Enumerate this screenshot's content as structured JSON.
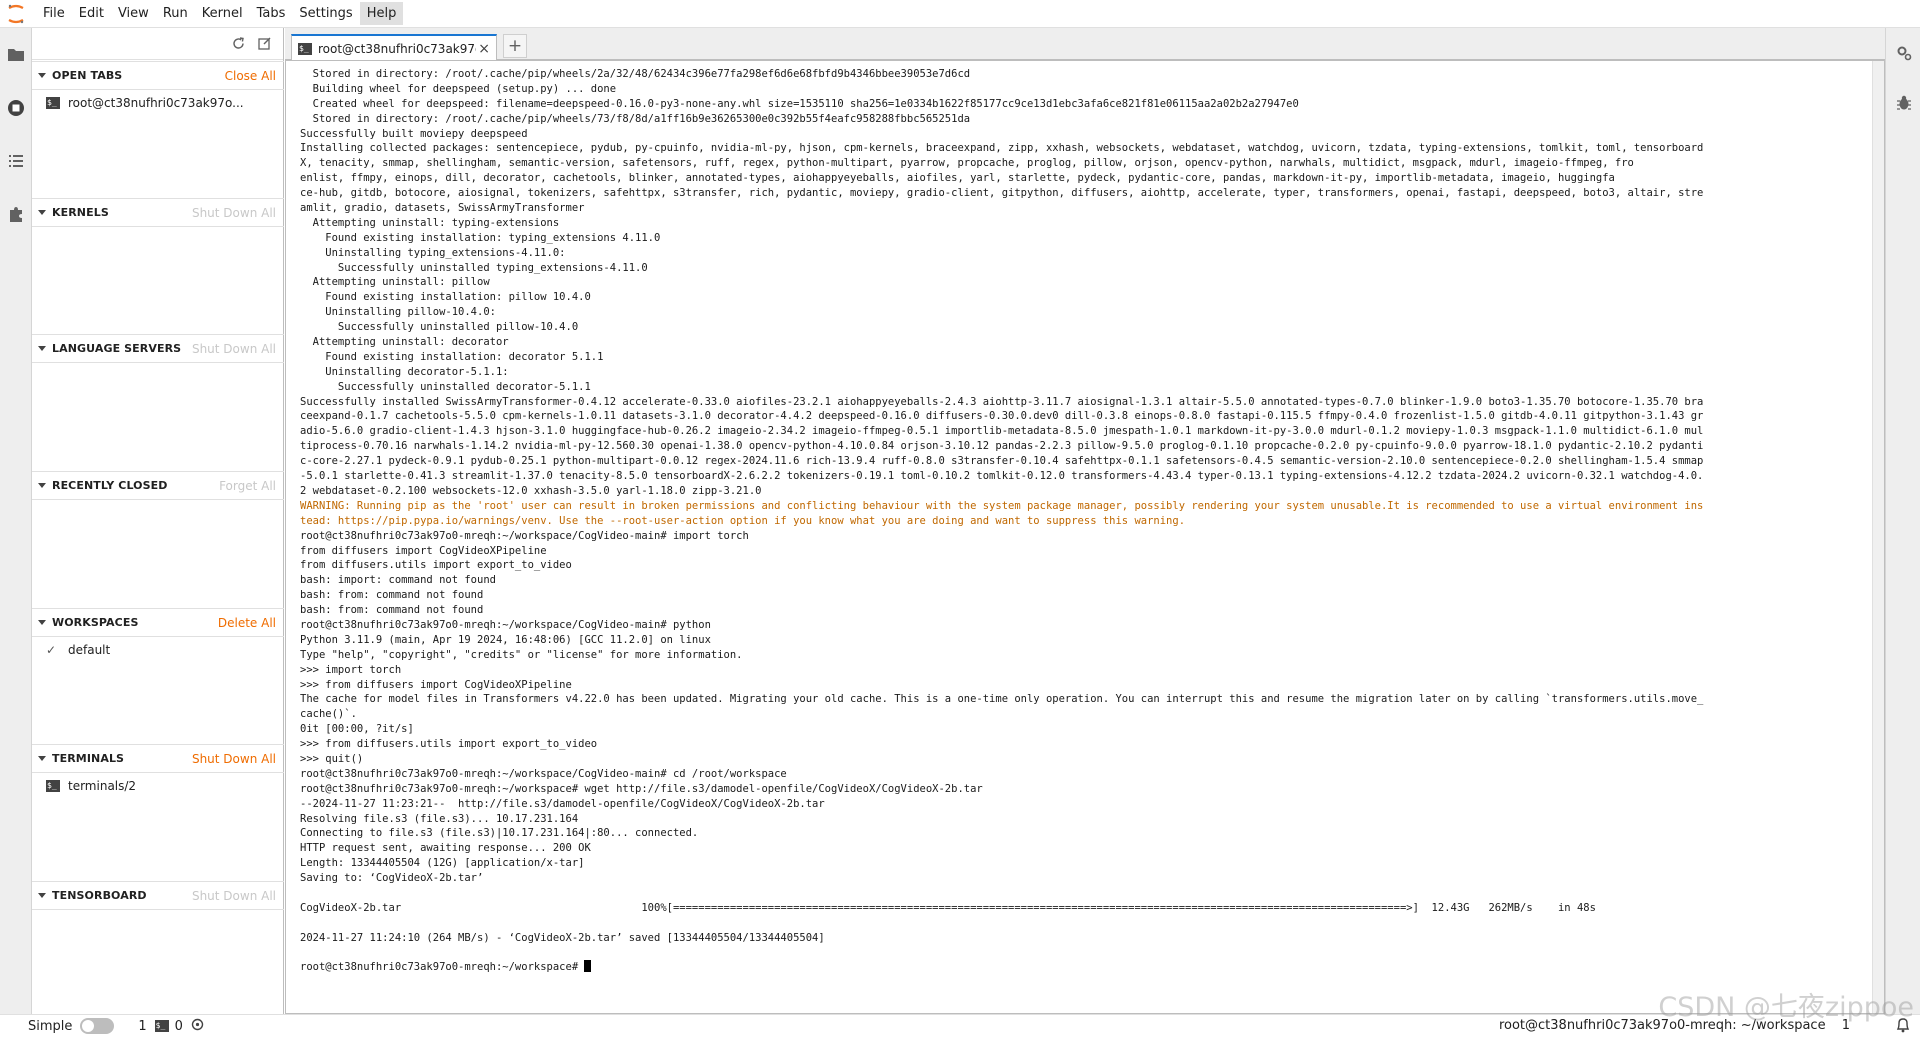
{
  "menubar": {
    "items": [
      "File",
      "Edit",
      "View",
      "Run",
      "Kernel",
      "Tabs",
      "Settings",
      "Help"
    ]
  },
  "sidebar": {
    "open_tabs": {
      "title": "OPEN TABS",
      "action": "Close All",
      "items": [
        "root@ct38nufhri0c73ak97o..."
      ]
    },
    "kernels": {
      "title": "KERNELS",
      "action": "Shut Down All"
    },
    "language_servers": {
      "title": "LANGUAGE SERVERS",
      "action": "Shut Down All"
    },
    "recently_closed": {
      "title": "RECENTLY CLOSED",
      "action": "Forget All"
    },
    "workspaces": {
      "title": "WORKSPACES",
      "action": "Delete All",
      "items": [
        "default"
      ]
    },
    "terminals": {
      "title": "TERMINALS",
      "action": "Shut Down All",
      "items": [
        "terminals/2"
      ]
    },
    "tensorboard": {
      "title": "TENSORBOARD",
      "action": "Shut Down All"
    }
  },
  "tab": {
    "label": "root@ct38nufhri0c73ak97o0",
    "close": "×",
    "add": "+"
  },
  "terminal": {
    "lines": [
      {
        "text": "  Stored in directory: /root/.cache/pip/wheels/2a/32/48/62434c396e77fa298ef6d6e68fbfd9b4346bbee39053e7d6cd"
      },
      {
        "text": "  Building wheel for deepspeed (setup.py) ... done"
      },
      {
        "text": "  Created wheel for deepspeed: filename=deepspeed-0.16.0-py3-none-any.whl size=1535110 sha256=1e0334b1622f85177cc9ce13d1ebc3afa6ce821f81e06115aa2a02b2a27947e0"
      },
      {
        "text": "  Stored in directory: /root/.cache/pip/wheels/73/f8/8d/a1ff16b9e36265300e0c392b55f4eafc958288fbbc565251da"
      },
      {
        "text": "Successfully built moviepy deepspeed"
      },
      {
        "text": "Installing collected packages: sentencepiece, pydub, py-cpuinfo, nvidia-ml-py, hjson, cpm-kernels, braceexpand, zipp, xxhash, websockets, webdataset, watchdog, uvicorn, tzdata, typing-extensions, tomlkit, toml, tensorboard"
      },
      {
        "text": "X, tenacity, smmap, shellingham, semantic-version, safetensors, ruff, regex, python-multipart, pyarrow, propcache, proglog, pillow, orjson, opencv-python, narwhals, multidict, msgpack, mdurl, imageio-ffmpeg, fro"
      },
      {
        "text": "enlist, ffmpy, einops, dill, decorator, cachetools, blinker, annotated-types, aiohappyeyeballs, aiofiles, yarl, starlette, pydeck, pydantic-core, pandas, markdown-it-py, importlib-metadata, imageio, huggingfa"
      },
      {
        "text": "ce-hub, gitdb, botocore, aiosignal, tokenizers, safehttpx, s3transfer, rich, pydantic, moviepy, gradio-client, gitpython, diffusers, aiohttp, accelerate, typer, transformers, openai, fastapi, deepspeed, boto3, altair, stre"
      },
      {
        "text": "amlit, gradio, datasets, SwissArmyTransformer"
      },
      {
        "text": "  Attempting uninstall: typing-extensions"
      },
      {
        "text": "    Found existing installation: typing_extensions 4.11.0"
      },
      {
        "text": "    Uninstalling typing_extensions-4.11.0:"
      },
      {
        "text": "      Successfully uninstalled typing_extensions-4.11.0"
      },
      {
        "text": "  Attempting uninstall: pillow"
      },
      {
        "text": "    Found existing installation: pillow 10.4.0"
      },
      {
        "text": "    Uninstalling pillow-10.4.0:"
      },
      {
        "text": "      Successfully uninstalled pillow-10.4.0"
      },
      {
        "text": "  Attempting uninstall: decorator"
      },
      {
        "text": "    Found existing installation: decorator 5.1.1"
      },
      {
        "text": "    Uninstalling decorator-5.1.1:"
      },
      {
        "text": "      Successfully uninstalled decorator-5.1.1"
      },
      {
        "text": "Successfully installed SwissArmyTransformer-0.4.12 accelerate-0.33.0 aiofiles-23.2.1 aiohappyeyeballs-2.4.3 aiohttp-3.11.7 aiosignal-1.3.1 altair-5.5.0 annotated-types-0.7.0 blinker-1.9.0 boto3-1.35.70 botocore-1.35.70 bra"
      },
      {
        "text": "ceexpand-0.1.7 cachetools-5.5.0 cpm-kernels-1.0.11 datasets-3.1.0 decorator-4.4.2 deepspeed-0.16.0 diffusers-0.30.0.dev0 dill-0.3.8 einops-0.8.0 fastapi-0.115.5 ffmpy-0.4.0 frozenlist-1.5.0 gitdb-4.0.11 gitpython-3.1.43 gr"
      },
      {
        "text": "adio-5.6.0 gradio-client-1.4.3 hjson-3.1.0 huggingface-hub-0.26.2 imageio-2.34.2 imageio-ffmpeg-0.5.1 importlib-metadata-8.5.0 jmespath-1.0.1 markdown-it-py-3.0.0 mdurl-0.1.2 moviepy-1.0.3 msgpack-1.1.0 multidict-6.1.0 mul"
      },
      {
        "text": "tiprocess-0.70.16 narwhals-1.14.2 nvidia-ml-py-12.560.30 openai-1.38.0 opencv-python-4.10.0.84 orjson-3.10.12 pandas-2.2.3 pillow-9.5.0 proglog-0.1.10 propcache-0.2.0 py-cpuinfo-9.0.0 pyarrow-18.1.0 pydantic-2.10.2 pydanti"
      },
      {
        "text": "c-core-2.27.1 pydeck-0.9.1 pydub-0.25.1 python-multipart-0.0.12 regex-2024.11.6 rich-13.9.4 ruff-0.8.0 s3transfer-0.10.4 safehttpx-0.1.1 safetensors-0.4.5 semantic-version-2.10.0 sentencepiece-0.2.0 shellingham-1.5.4 smmap"
      },
      {
        "text": "-5.0.1 starlette-0.41.3 streamlit-1.37.0 tenacity-8.5.0 tensorboardX-2.6.2.2 tokenizers-0.19.1 toml-0.10.2 tomlkit-0.12.0 transformers-4.43.4 typer-0.13.1 typing-extensions-4.12.2 tzdata-2024.2 uvicorn-0.32.1 watchdog-4.0."
      },
      {
        "text": "2 webdataset-0.2.100 websockets-12.0 xxhash-3.5.0 yarl-1.18.0 zipp-3.21.0"
      },
      {
        "text": "WARNING: Running pip as the 'root' user can result in broken permissions and conflicting behaviour with the system package manager, possibly rendering your system unusable.It is recommended to use a virtual environment ins",
        "warn": true
      },
      {
        "text": "tead: https://pip.pypa.io/warnings/venv. Use the --root-user-action option if you know what you are doing and want to suppress this warning.",
        "warn": true
      },
      {
        "text": "root@ct38nufhri0c73ak97o0-mreqh:~/workspace/CogVideo-main# import torch"
      },
      {
        "text": "from diffusers import CogVideoXPipeline"
      },
      {
        "text": "from diffusers.utils import export_to_video"
      },
      {
        "text": "bash: import: command not found"
      },
      {
        "text": "bash: from: command not found"
      },
      {
        "text": "bash: from: command not found"
      },
      {
        "text": "root@ct38nufhri0c73ak97o0-mreqh:~/workspace/CogVideo-main# python"
      },
      {
        "text": "Python 3.11.9 (main, Apr 19 2024, 16:48:06) [GCC 11.2.0] on linux"
      },
      {
        "text": "Type \"help\", \"copyright\", \"credits\" or \"license\" for more information."
      },
      {
        "text": ">>> import torch"
      },
      {
        "text": ">>> from diffusers import CogVideoXPipeline"
      },
      {
        "text": "The cache for model files in Transformers v4.22.0 has been updated. Migrating your old cache. This is a one-time only operation. You can interrupt this and resume the migration later on by calling `transformers.utils.move_"
      },
      {
        "text": "cache()`."
      },
      {
        "text": "0it [00:00, ?it/s]"
      },
      {
        "text": ">>> from diffusers.utils import export_to_video"
      },
      {
        "text": ">>> quit()"
      },
      {
        "text": "root@ct38nufhri0c73ak97o0-mreqh:~/workspace/CogVideo-main# cd /root/workspace"
      },
      {
        "text": "root@ct38nufhri0c73ak97o0-mreqh:~/workspace# wget http://file.s3/damodel-openfile/CogVideoX/CogVideoX-2b.tar"
      },
      {
        "text": "--2024-11-27 11:23:21--  http://file.s3/damodel-openfile/CogVideoX/CogVideoX-2b.tar"
      },
      {
        "text": "Resolving file.s3 (file.s3)... 10.17.231.164"
      },
      {
        "text": "Connecting to file.s3 (file.s3)|10.17.231.164|:80... connected."
      },
      {
        "text": "HTTP request sent, awaiting response... 200 OK"
      },
      {
        "text": "Length: 13344405504 (12G) [application/x-tar]"
      },
      {
        "text": "Saving to: ‘CogVideoX-2b.tar’"
      },
      {
        "text": ""
      },
      {
        "text": "CogVideoX-2b.tar                                      100%[====================================================================================================================>]  12.43G   262MB/s    in 48s"
      },
      {
        "text": ""
      },
      {
        "text": "2024-11-27 11:24:10 (264 MB/s) - ‘CogVideoX-2b.tar’ saved [13344405504/13344405504]"
      },
      {
        "text": ""
      },
      {
        "text": "root@ct38nufhri0c73ak97o0-mreqh:~/workspace# ",
        "cursor": true
      }
    ]
  },
  "statusbar": {
    "simple_label": "Simple",
    "kernels_count": "1",
    "terminals_count": "0",
    "right_text": "root@ct38nufhri0c73ak97o0-mreqh: ~/workspace",
    "notifications_count": "1"
  },
  "watermark": "CSDN @七夜zippoe",
  "icons": {
    "logo": "jupyter-logo-icon",
    "activity": [
      "folder-icon",
      "running-circle-icon",
      "toc-list-icon",
      "puzzle-extension-icon"
    ],
    "right": [
      "property-inspector-icon",
      "debugger-bug-icon"
    ],
    "sidebar_toolbar": [
      "refresh-icon",
      "new-launcher-icon"
    ]
  },
  "colors": {
    "accent": "#1976d2",
    "action": "#ef6c00",
    "warning_text": "#c06800"
  }
}
